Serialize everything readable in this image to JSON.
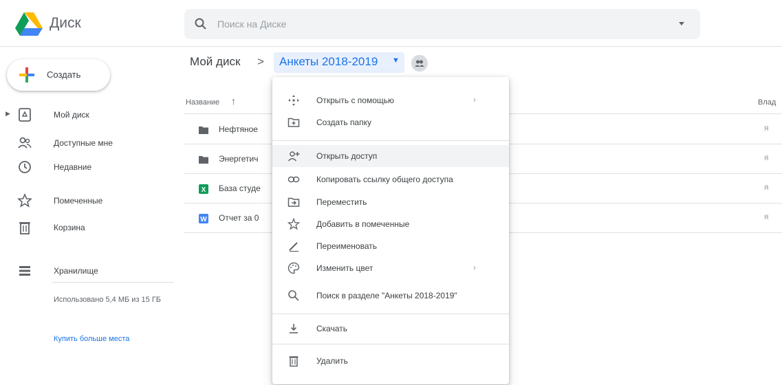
{
  "app": {
    "name": "Диск"
  },
  "search": {
    "placeholder": "Поиск на Диске"
  },
  "sidebar": {
    "create_label": "Создать",
    "items": [
      {
        "label": "Мой диск",
        "icon": "drive-icon"
      },
      {
        "label": "Доступные мне",
        "icon": "shared-people-icon"
      },
      {
        "label": "Недавние",
        "icon": "clock-icon"
      },
      {
        "label": "Помеченные",
        "icon": "star-icon"
      },
      {
        "label": "Корзина",
        "icon": "trash-icon"
      },
      {
        "label": "Хранилище",
        "icon": "storage-icon"
      }
    ],
    "storage_used": "Использовано 5,4 МБ из 15 ГБ",
    "buy_more": "Купить больше места"
  },
  "breadcrumb": {
    "root": "Мой диск",
    "separator": ">",
    "current": "Анкеты 2018-2019",
    "caret": "▼"
  },
  "file_list": {
    "col_name": "Название",
    "sort_arrow": "↑",
    "col_owner": "Влад",
    "rows": [
      {
        "name": "Нефтяное",
        "type": "folder",
        "owner": "я"
      },
      {
        "name": "Энергетич",
        "type": "folder",
        "owner": "я"
      },
      {
        "name": "База студе",
        "type": "sheets",
        "owner": "я"
      },
      {
        "name": "Отчет за 0",
        "type": "docs",
        "owner": "я"
      }
    ]
  },
  "context_menu": {
    "items": [
      {
        "label": "Открыть с помощью",
        "icon": "open-with-icon",
        "submenu": "›"
      },
      {
        "label": "Создать папку",
        "icon": "new-folder-icon"
      },
      {
        "label": "Открыть доступ",
        "icon": "add-person-icon"
      },
      {
        "label": "Копировать ссылку общего доступа",
        "icon": "link-icon"
      },
      {
        "label": "Переместить",
        "icon": "move-icon"
      },
      {
        "label": "Добавить в помеченные",
        "icon": "star-icon"
      },
      {
        "label": "Переименовать",
        "icon": "pencil-icon"
      },
      {
        "label": "Изменить цвет",
        "icon": "palette-icon",
        "submenu": "›"
      },
      {
        "label": "Поиск в разделе \"Анкеты 2018-2019\"",
        "icon": "search-icon"
      },
      {
        "label": "Скачать",
        "icon": "download-icon"
      },
      {
        "label": "Удалить",
        "icon": "trash-icon"
      }
    ]
  },
  "colors": {
    "accent": "#1a73e8",
    "sheets_green": "#0f9d58",
    "docs_blue": "#4285f4",
    "folder_gray": "#5f6368",
    "menu_hover": "#f1f3f4"
  }
}
